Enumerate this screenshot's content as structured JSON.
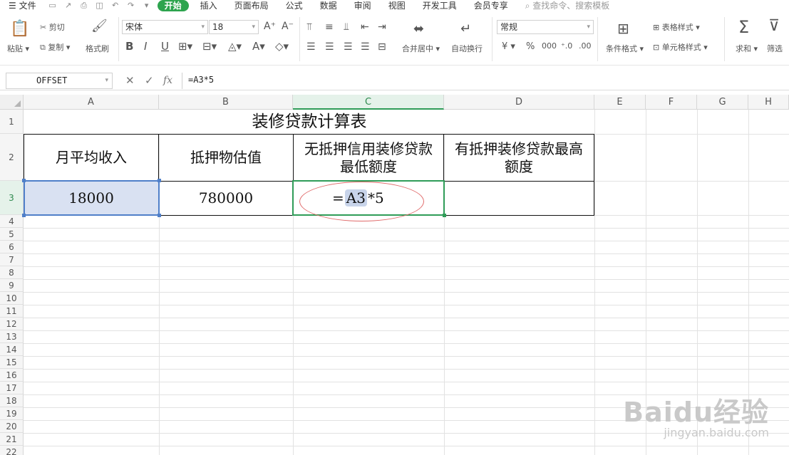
{
  "menu": {
    "file": "文件",
    "tabs": [
      "开始",
      "插入",
      "页面布局",
      "公式",
      "数据",
      "审阅",
      "视图",
      "开发工具",
      "会员专享"
    ],
    "active_tab": "开始",
    "search": "查找命令、搜索模板"
  },
  "ribbon": {
    "paste": "粘贴",
    "cut": "剪切",
    "copy": "复制",
    "format_painter": "格式刷",
    "font_name": "宋体",
    "font_size": "18",
    "merge_center": "合并居中",
    "auto_wrap": "自动换行",
    "number_format": "常规",
    "conditional_format": "条件格式",
    "table_style": "表格样式",
    "cell_style": "单元格样式",
    "sum": "求和",
    "filter": "筛选"
  },
  "formula_bar": {
    "name_box": "OFFSET",
    "fx": "fx",
    "content": "=A3*5"
  },
  "grid": {
    "columns": [
      "A",
      "B",
      "C",
      "D",
      "E",
      "F",
      "G",
      "H"
    ],
    "selected_column": "C",
    "rows": [
      "1",
      "2",
      "3",
      "4",
      "5",
      "6",
      "7",
      "8",
      "9",
      "10",
      "11",
      "12",
      "13",
      "14",
      "15",
      "16",
      "17",
      "18",
      "19",
      "20",
      "21",
      "22"
    ],
    "selected_row": "3"
  },
  "sheet": {
    "title": "装修贷款计算表",
    "headers": [
      "月平均收入",
      "抵押物估值",
      "无抵押信用装修贷款最低额度",
      "有抵押装修贷款最高额度"
    ],
    "row3": {
      "A": "18000",
      "B": "780000",
      "D": ""
    },
    "editing": {
      "prefix": "=",
      "ref": "A3",
      "suffix": "*5"
    }
  },
  "watermark": {
    "brand": "Baidu经验",
    "url": "jingyan.baidu.com"
  },
  "colors": {
    "accent_green": "#2da44e",
    "selection_blue": "#4f7fc9",
    "annotation_red": "#e06a6a"
  }
}
